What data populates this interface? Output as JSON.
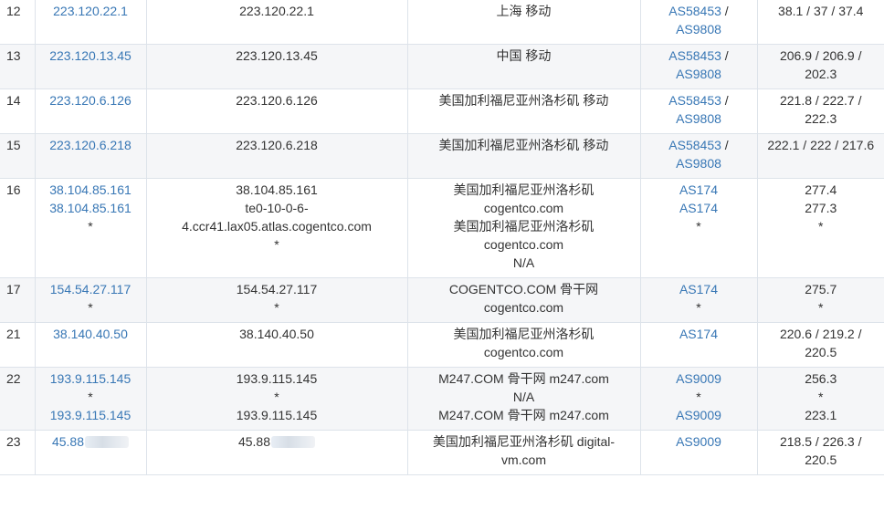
{
  "rows": [
    {
      "no": "12",
      "ip": [
        "223.120.22.1"
      ],
      "host": [
        "223.120.22.1"
      ],
      "loc": [
        "上海 移动"
      ],
      "asn": [
        [
          "AS58453",
          " /"
        ],
        [
          "AS9808",
          ""
        ]
      ],
      "rtt": [
        "38.1 / 37 / 37.4"
      ]
    },
    {
      "no": "13",
      "ip": [
        "223.120.13.45"
      ],
      "host": [
        "223.120.13.45"
      ],
      "loc": [
        "中国 移动"
      ],
      "asn": [
        [
          "AS58453",
          " /"
        ],
        [
          "AS9808",
          ""
        ]
      ],
      "rtt": [
        "206.9 / 206.9 /",
        "202.3"
      ]
    },
    {
      "no": "14",
      "ip": [
        "223.120.6.126"
      ],
      "host": [
        "223.120.6.126"
      ],
      "loc": [
        "美国加利福尼亚州洛杉矶 移动"
      ],
      "asn": [
        [
          "AS58453",
          " /"
        ],
        [
          "AS9808",
          ""
        ]
      ],
      "rtt": [
        "221.8 / 222.7 /",
        "222.3"
      ]
    },
    {
      "no": "15",
      "ip": [
        "223.120.6.218"
      ],
      "host": [
        "223.120.6.218"
      ],
      "loc": [
        "美国加利福尼亚州洛杉矶 移动"
      ],
      "asn": [
        [
          "AS58453",
          " /"
        ],
        [
          "AS9808",
          ""
        ]
      ],
      "rtt": [
        "222.1 / 222 / 217.6"
      ]
    },
    {
      "no": "16",
      "ip": [
        "38.104.85.161",
        "38.104.85.161",
        "*"
      ],
      "host": [
        "38.104.85.161",
        "te0-10-0-6-",
        "4.ccr41.lax05.atlas.cogentco.com",
        "*"
      ],
      "loc": [
        "美国加利福尼亚州洛杉矶",
        "cogentco.com",
        "美国加利福尼亚州洛杉矶",
        "cogentco.com",
        "N/A"
      ],
      "asn": [
        [
          "AS174",
          ""
        ],
        [
          "AS174",
          ""
        ],
        [
          "*",
          ""
        ]
      ],
      "rtt": [
        "277.4",
        "277.3",
        "*"
      ]
    },
    {
      "no": "17",
      "ip": [
        "154.54.27.117",
        "*"
      ],
      "host": [
        "154.54.27.117",
        "*"
      ],
      "loc": [
        "COGENTCO.COM 骨干网",
        "cogentco.com"
      ],
      "asn": [
        [
          "AS174",
          ""
        ],
        [
          "*",
          ""
        ]
      ],
      "rtt": [
        "275.7",
        "*"
      ]
    },
    {
      "no": "21",
      "ip": [
        "38.140.40.50"
      ],
      "host": [
        "38.140.40.50"
      ],
      "loc": [
        "美国加利福尼亚州洛杉矶",
        "cogentco.com"
      ],
      "asn": [
        [
          "AS174",
          ""
        ]
      ],
      "rtt": [
        "220.6 / 219.2 /",
        "220.5"
      ]
    },
    {
      "no": "22",
      "ip": [
        "193.9.115.145",
        "*",
        "193.9.115.145"
      ],
      "host": [
        "193.9.115.145",
        "*",
        "193.9.115.145"
      ],
      "loc": [
        "M247.COM 骨干网 m247.com",
        "N/A",
        "M247.COM 骨干网 m247.com"
      ],
      "asn": [
        [
          "AS9009",
          ""
        ],
        [
          "*",
          ""
        ],
        [
          "AS9009",
          ""
        ]
      ],
      "rtt": [
        "256.3",
        "*",
        "223.1"
      ]
    },
    {
      "no": "23",
      "ip": [
        "45.88"
      ],
      "host": [
        "45.88"
      ],
      "loc": [
        "美国加利福尼亚州洛杉矶 digital-",
        "vm.com"
      ],
      "asn": [
        [
          "AS9009",
          ""
        ]
      ],
      "rtt": [
        "218.5 / 226.3 /",
        "220.5"
      ]
    }
  ]
}
